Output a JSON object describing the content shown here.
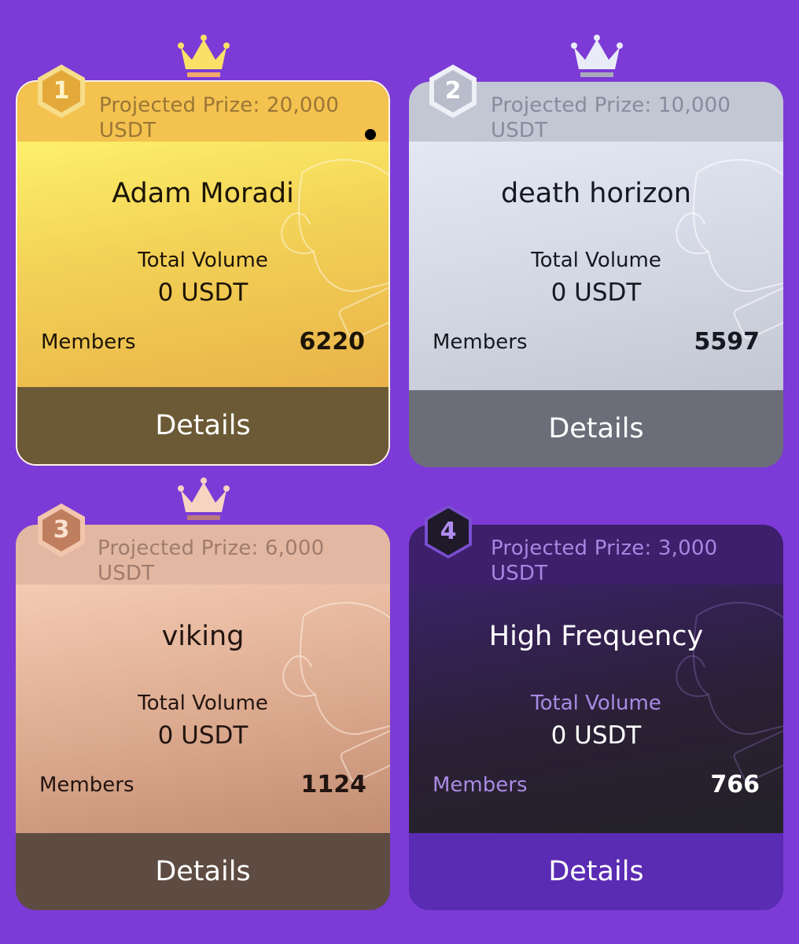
{
  "colors": {
    "page_background": "#7c3bd6",
    "gold": "#f4c24f",
    "silver": "#c3c7d4",
    "bronze": "#e2b8a3",
    "dark": "#3d1f6c"
  },
  "labels": {
    "total_volume": "Total Volume",
    "members": "Members",
    "details": "Details"
  },
  "teams": [
    {
      "rank": "1",
      "tier": "gold",
      "prize_line1": "Projected Prize: 20,000",
      "prize_line2": "USDT",
      "name": "Adam Moradi",
      "volume": "0 USDT",
      "members": "6220",
      "is_user_team": true,
      "icons": [
        "crown-icon",
        "user-icon",
        "boxing-glove-icon"
      ]
    },
    {
      "rank": "2",
      "tier": "silver",
      "prize_line1": "Projected Prize: 10,000",
      "prize_line2": "USDT",
      "name": "death horizon",
      "volume": "0 USDT",
      "members": "5597",
      "is_user_team": false,
      "icons": [
        "crown-icon",
        "boxing-glove-icon"
      ]
    },
    {
      "rank": "3",
      "tier": "bronze",
      "prize_line1": "Projected Prize: 6,000",
      "prize_line2": "USDT",
      "name": "viking",
      "volume": "0 USDT",
      "members": "1124",
      "is_user_team": false,
      "icons": [
        "crown-icon",
        "boxing-glove-icon"
      ]
    },
    {
      "rank": "4",
      "tier": "dark",
      "prize_line1": "Projected Prize: 3,000",
      "prize_line2": "USDT",
      "name": "High Frequency",
      "volume": "0 USDT",
      "members": "766",
      "is_user_team": false,
      "icons": [
        "boxing-glove-icon"
      ]
    }
  ]
}
